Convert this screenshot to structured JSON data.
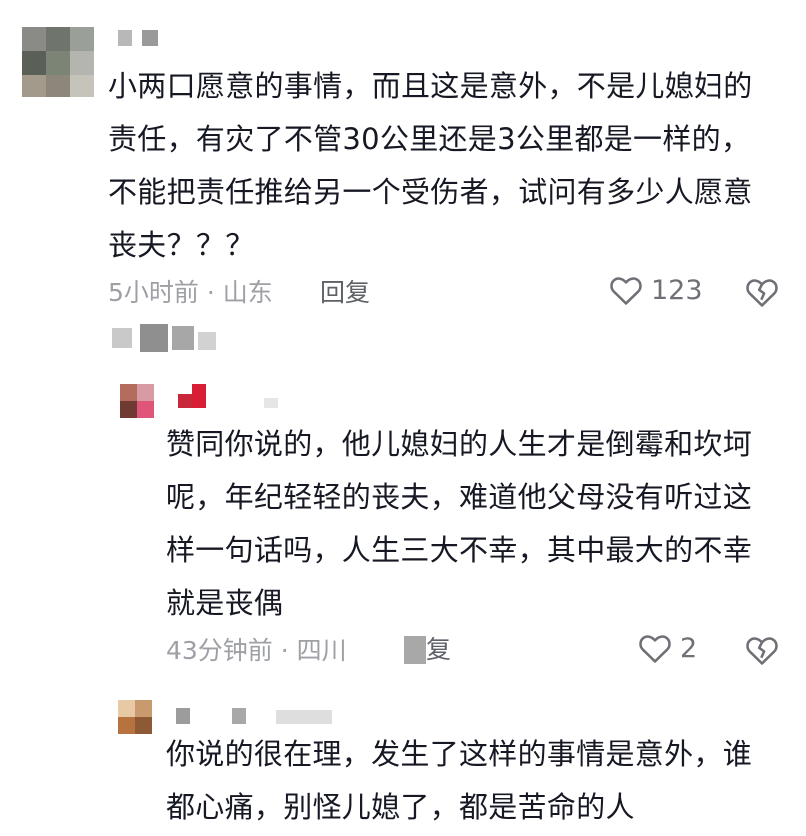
{
  "comments": [
    {
      "text": "小两口愿意的事情，而且这是意外，不是儿媳妇的责任，有灾了不管30公里还是3公里都是一样的，不能把责任推给另一个受伤者，试问有多少人愿意丧夫？？？",
      "time": "5小时前",
      "location": "山东",
      "reply_label": "回复",
      "likes": "123"
    },
    {
      "text": "赞同你说的，他儿媳妇的人生才是倒霉和坎坷呢，年纪轻轻的丧夫，难道他父母没有听过这样一句话吗，人生三大不幸，其中最大的不幸就是丧偶",
      "time": "43分钟前",
      "location": "四川",
      "reply_label": "复",
      "likes": "2"
    },
    {
      "text": "你说的很在理，发生了这样的事情是意外，谁都心痛，别怪儿媳了，都是苦命的人"
    }
  ],
  "icons": [
    "heart-outline-icon",
    "broken-heart-icon"
  ]
}
